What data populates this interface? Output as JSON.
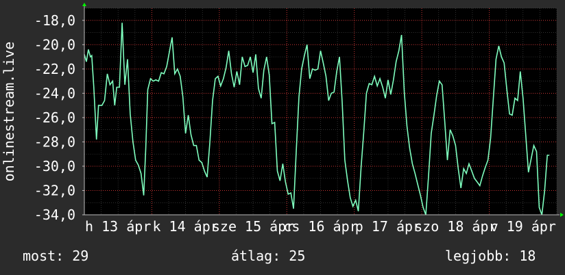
{
  "chart_data": {
    "type": "line",
    "ylabel": "onlinestream.live",
    "ylim": [
      -34,
      -17
    ],
    "yticks": [
      -18,
      -20,
      -22,
      -24,
      -26,
      -28,
      -30,
      -32,
      -34
    ],
    "ytick_labels": [
      "-18,0",
      "-20,0",
      "-22,0",
      "-24,0",
      "-26,0",
      "-28,0",
      "-30,0",
      "-32,0",
      "-34,0"
    ],
    "xlim": [
      0,
      7
    ],
    "xticks": [
      0,
      1,
      2,
      3,
      4,
      5,
      6
    ],
    "xtick_labels": [
      "h 13 ápr",
      "k 14 ápr",
      "sze 15 ápr",
      "cs 16 ápr",
      "p 17 ápr",
      "szo 18 ápr",
      "v 19 ápr"
    ],
    "grid": true,
    "colors": {
      "background": "#2b2b2b",
      "plot": "#000000",
      "grid": "#c83232",
      "line": "#7fffbf",
      "axis_arrow": "#00ff00"
    },
    "series": [
      {
        "values": [
          [
            0.0,
            -20.8
          ],
          [
            0.03,
            -21.4
          ],
          [
            0.06,
            -20.4
          ],
          [
            0.09,
            -21.0
          ],
          [
            0.11,
            -20.9
          ],
          [
            0.14,
            -23.5
          ],
          [
            0.18,
            -27.8
          ],
          [
            0.21,
            -25.0
          ],
          [
            0.26,
            -25.0
          ],
          [
            0.3,
            -24.6
          ],
          [
            0.34,
            -22.4
          ],
          [
            0.38,
            -23.3
          ],
          [
            0.42,
            -23.0
          ],
          [
            0.45,
            -25.0
          ],
          [
            0.48,
            -23.5
          ],
          [
            0.52,
            -23.5
          ],
          [
            0.56,
            -18.2
          ],
          [
            0.6,
            -23.3
          ],
          [
            0.64,
            -21.2
          ],
          [
            0.68,
            -25.7
          ],
          [
            0.72,
            -28.0
          ],
          [
            0.76,
            -29.5
          ],
          [
            0.8,
            -29.9
          ],
          [
            0.84,
            -30.6
          ],
          [
            0.88,
            -32.4
          ],
          [
            0.91,
            -28.5
          ],
          [
            0.94,
            -23.7
          ],
          [
            0.98,
            -22.8
          ],
          [
            1.02,
            -23.0
          ],
          [
            1.06,
            -22.9
          ],
          [
            1.1,
            -23.0
          ],
          [
            1.14,
            -22.3
          ],
          [
            1.18,
            -22.4
          ],
          [
            1.22,
            -21.8
          ],
          [
            1.26,
            -20.6
          ],
          [
            1.3,
            -19.4
          ],
          [
            1.34,
            -22.4
          ],
          [
            1.38,
            -22.0
          ],
          [
            1.42,
            -22.6
          ],
          [
            1.46,
            -24.3
          ],
          [
            1.5,
            -27.3
          ],
          [
            1.54,
            -25.8
          ],
          [
            1.58,
            -27.4
          ],
          [
            1.62,
            -28.3
          ],
          [
            1.66,
            -28.3
          ],
          [
            1.7,
            -29.5
          ],
          [
            1.74,
            -29.7
          ],
          [
            1.78,
            -30.4
          ],
          [
            1.82,
            -30.9
          ],
          [
            1.86,
            -28.0
          ],
          [
            1.9,
            -24.6
          ],
          [
            1.94,
            -22.8
          ],
          [
            1.98,
            -22.6
          ],
          [
            2.02,
            -23.4
          ],
          [
            2.06,
            -22.8
          ],
          [
            2.1,
            -21.9
          ],
          [
            2.14,
            -20.5
          ],
          [
            2.18,
            -22.4
          ],
          [
            2.22,
            -23.5
          ],
          [
            2.26,
            -22.2
          ],
          [
            2.3,
            -23.3
          ],
          [
            2.34,
            -21.0
          ],
          [
            2.38,
            -21.8
          ],
          [
            2.42,
            -21.7
          ],
          [
            2.46,
            -21.0
          ],
          [
            2.5,
            -22.3
          ],
          [
            2.54,
            -20.8
          ],
          [
            2.58,
            -23.6
          ],
          [
            2.62,
            -24.4
          ],
          [
            2.66,
            -22.1
          ],
          [
            2.7,
            -21.0
          ],
          [
            2.74,
            -22.5
          ],
          [
            2.78,
            -26.5
          ],
          [
            2.82,
            -26.4
          ],
          [
            2.86,
            -30.4
          ],
          [
            2.9,
            -31.2
          ],
          [
            2.94,
            -29.8
          ],
          [
            2.98,
            -31.3
          ],
          [
            3.02,
            -32.3
          ],
          [
            3.06,
            -32.2
          ],
          [
            3.1,
            -33.5
          ],
          [
            3.14,
            -28.7
          ],
          [
            3.18,
            -24.3
          ],
          [
            3.22,
            -22.0
          ],
          [
            3.26,
            -20.9
          ],
          [
            3.3,
            -20.0
          ],
          [
            3.34,
            -22.8
          ],
          [
            3.38,
            -22.0
          ],
          [
            3.42,
            -22.1
          ],
          [
            3.46,
            -22.0
          ],
          [
            3.5,
            -20.5
          ],
          [
            3.54,
            -21.5
          ],
          [
            3.58,
            -22.6
          ],
          [
            3.62,
            -24.6
          ],
          [
            3.66,
            -24.0
          ],
          [
            3.7,
            -23.9
          ],
          [
            3.74,
            -22.2
          ],
          [
            3.78,
            -21.0
          ],
          [
            3.82,
            -24.7
          ],
          [
            3.86,
            -29.5
          ],
          [
            3.9,
            -31.2
          ],
          [
            3.94,
            -32.6
          ],
          [
            3.98,
            -33.3
          ],
          [
            4.02,
            -32.8
          ],
          [
            4.06,
            -33.7
          ],
          [
            4.1,
            -30.1
          ],
          [
            4.14,
            -27.2
          ],
          [
            4.18,
            -24.0
          ],
          [
            4.22,
            -23.2
          ],
          [
            4.26,
            -23.3
          ],
          [
            4.3,
            -22.6
          ],
          [
            4.34,
            -23.4
          ],
          [
            4.38,
            -22.8
          ],
          [
            4.42,
            -23.5
          ],
          [
            4.46,
            -24.4
          ],
          [
            4.5,
            -22.9
          ],
          [
            4.54,
            -24.1
          ],
          [
            4.58,
            -22.9
          ],
          [
            4.62,
            -21.4
          ],
          [
            4.66,
            -20.5
          ],
          [
            4.7,
            -19.2
          ],
          [
            4.74,
            -23.9
          ],
          [
            4.78,
            -26.7
          ],
          [
            4.82,
            -28.5
          ],
          [
            4.86,
            -29.8
          ],
          [
            4.9,
            -30.6
          ],
          [
            4.94,
            -31.5
          ],
          [
            4.98,
            -32.4
          ],
          [
            5.02,
            -33.4
          ],
          [
            5.06,
            -34.0
          ],
          [
            5.1,
            -30.8
          ],
          [
            5.14,
            -27.3
          ],
          [
            5.18,
            -25.8
          ],
          [
            5.22,
            -24.2
          ],
          [
            5.26,
            -23.0
          ],
          [
            5.3,
            -23.3
          ],
          [
            5.34,
            -26.3
          ],
          [
            5.38,
            -29.5
          ],
          [
            5.42,
            -27.0
          ],
          [
            5.46,
            -27.5
          ],
          [
            5.5,
            -28.3
          ],
          [
            5.54,
            -30.2
          ],
          [
            5.58,
            -31.8
          ],
          [
            5.62,
            -30.2
          ],
          [
            5.66,
            -30.6
          ],
          [
            5.7,
            -29.8
          ],
          [
            5.74,
            -30.4
          ],
          [
            5.78,
            -31.0
          ],
          [
            5.82,
            -31.3
          ],
          [
            5.86,
            -31.6
          ],
          [
            5.9,
            -30.8
          ],
          [
            5.94,
            -30.1
          ],
          [
            5.98,
            -29.5
          ],
          [
            6.02,
            -27.7
          ],
          [
            6.06,
            -24.4
          ],
          [
            6.1,
            -21.2
          ],
          [
            6.14,
            -20.1
          ],
          [
            6.18,
            -21.0
          ],
          [
            6.22,
            -21.5
          ],
          [
            6.26,
            -23.7
          ],
          [
            6.3,
            -25.7
          ],
          [
            6.34,
            -25.8
          ],
          [
            6.38,
            -24.4
          ],
          [
            6.42,
            -24.6
          ],
          [
            6.46,
            -22.2
          ],
          [
            6.5,
            -24.4
          ],
          [
            6.54,
            -27.4
          ],
          [
            6.58,
            -30.5
          ],
          [
            6.62,
            -29.4
          ],
          [
            6.66,
            -28.3
          ],
          [
            6.7,
            -28.8
          ],
          [
            6.74,
            -33.4
          ],
          [
            6.78,
            -34.0
          ],
          [
            6.82,
            -32.0
          ],
          [
            6.86,
            -29.1
          ],
          [
            6.89,
            -29.1
          ]
        ]
      }
    ]
  },
  "footer": {
    "current": "most: 29",
    "average": "átlag: 25",
    "best": "legjobb: 18"
  }
}
